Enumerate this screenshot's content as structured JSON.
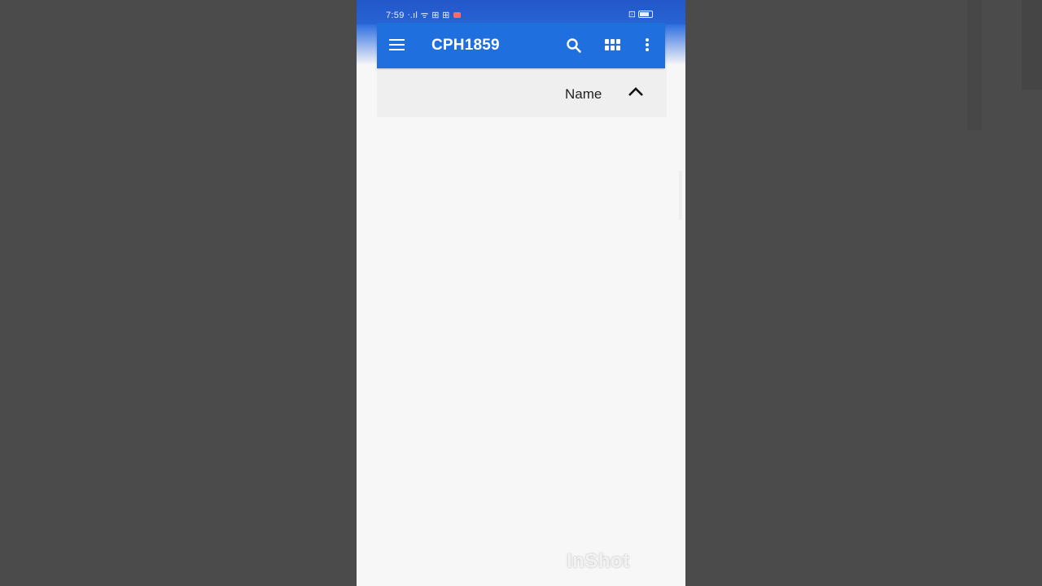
{
  "status_bar": {
    "time": "7:59",
    "indicators": "ᐧ.ıl ᯤ ⊞ ⊞",
    "battery_text": "⊡"
  },
  "app_bar": {
    "title": "CPH1859",
    "icons": [
      "menu-icon",
      "search-icon",
      "grid-view-icon",
      "more-vert-icon"
    ]
  },
  "sort_bar": {
    "label": "Name",
    "direction_icon": "chevron-up-icon"
  },
  "watermark": {
    "text": "InShot"
  },
  "colors": {
    "app_bar": "#1f6fdf",
    "status_bar": "#2257c9",
    "backdrop": "#4b4b4b",
    "surface": "#f7f7f7"
  }
}
